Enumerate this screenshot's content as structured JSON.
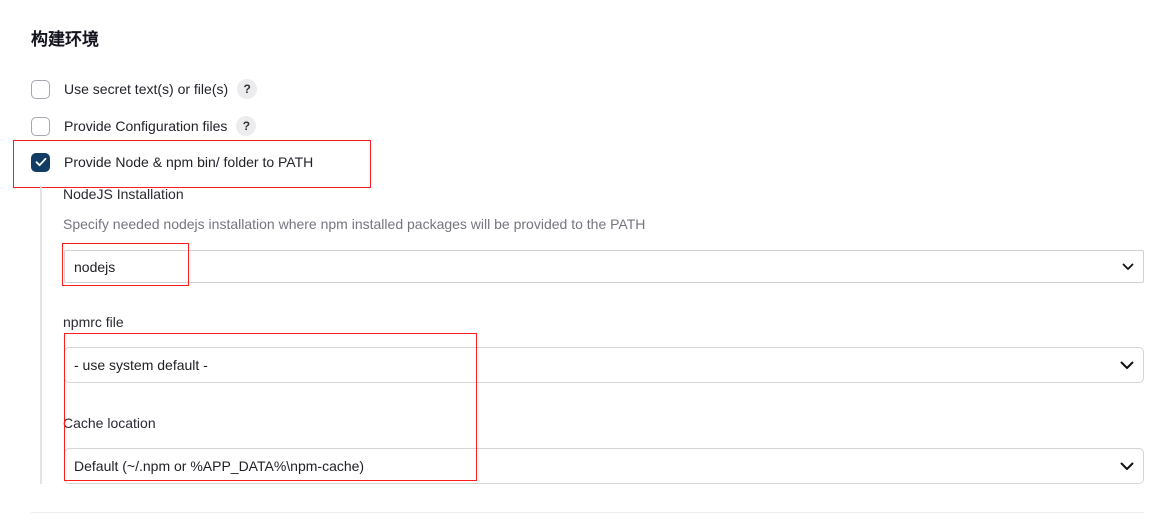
{
  "section": {
    "title": "构建环境"
  },
  "options": [
    {
      "label": "Use secret text(s) or file(s)",
      "checked": false,
      "help": "?"
    },
    {
      "label": "Provide Configuration files",
      "checked": false,
      "help": "?"
    },
    {
      "label": "Provide Node & npm bin/ folder to PATH",
      "checked": true
    }
  ],
  "node": {
    "installation_label": "NodeJS Installation",
    "installation_desc": "Specify needed nodejs installation where npm installed packages will be provided to the PATH",
    "installation_value": "nodejs",
    "npmrc_label": "npmrc file",
    "npmrc_value": "- use system default -",
    "cache_label": "Cache location",
    "cache_value": "Default (~/.npm or %APP_DATA%\\npm-cache)"
  },
  "colors": {
    "checkbox_checked": "#113c63",
    "annotation_red": "#ff1c1c"
  }
}
